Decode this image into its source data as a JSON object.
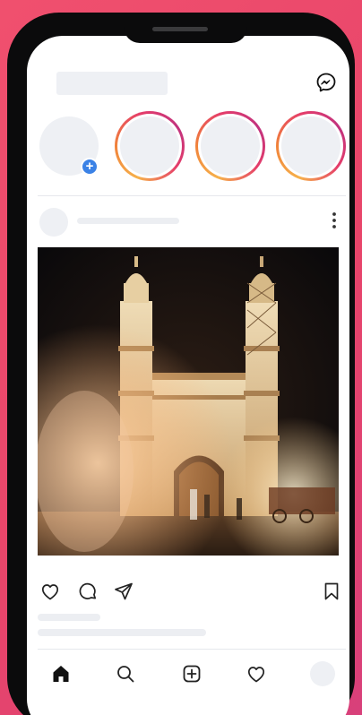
{
  "header": {
    "messenger_icon": "messenger-icon"
  },
  "stories": {
    "own_story_add_icon": "plus-icon",
    "count": 3
  },
  "post": {
    "image_subject": "",
    "actions": [
      "heart-icon",
      "comment-icon",
      "share-icon",
      "bookmark-icon"
    ]
  },
  "bottom_nav": {
    "items": [
      "home-icon",
      "search-icon",
      "add-post-icon",
      "activity-heart-icon",
      "profile-avatar"
    ]
  },
  "colors": {
    "background": "#e8456a",
    "story_ring": "#e53d6a",
    "add_badge": "#3b82e6"
  }
}
